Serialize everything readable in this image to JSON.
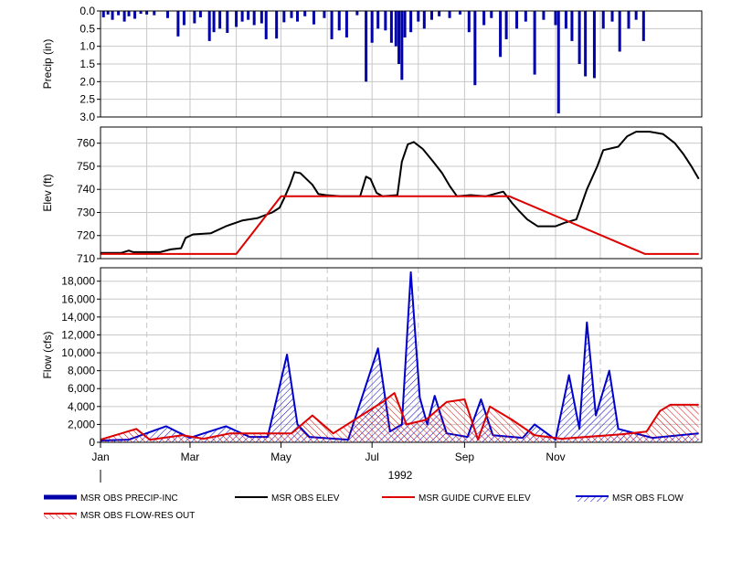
{
  "chart_data": {
    "type": "multi-panel time series",
    "x_axis": {
      "year_label": "1992",
      "tick_labels": [
        "Jan",
        "Mar",
        "May",
        "Jul",
        "Sep",
        "Nov"
      ],
      "range": [
        "1992-01-01",
        "1992-12-31"
      ]
    },
    "panels": [
      {
        "name": "precip",
        "type": "bar",
        "ylabel": "Precip (in)",
        "inverted": true,
        "ylim": [
          0,
          3.0
        ],
        "y_ticks": [
          "0.0",
          "0.5",
          "1.0",
          "1.5",
          "2.0",
          "2.5",
          "3.0"
        ],
        "series": [
          {
            "name": "MSR OBS PRECIP-INC",
            "color": "#0000aa",
            "points": [
              [
                "1992-01-03",
                0.18
              ],
              [
                "1992-01-06",
                0.1
              ],
              [
                "1992-01-09",
                0.25
              ],
              [
                "1992-01-13",
                0.12
              ],
              [
                "1992-01-17",
                0.3
              ],
              [
                "1992-01-20",
                0.15
              ],
              [
                "1992-01-24",
                0.22
              ],
              [
                "1992-01-28",
                0.08
              ],
              [
                "1992-02-01",
                0.1
              ],
              [
                "1992-02-06",
                0.12
              ],
              [
                "1992-02-15",
                0.2
              ],
              [
                "1992-02-22",
                0.72
              ],
              [
                "1992-02-26",
                0.4
              ],
              [
                "1992-03-04",
                0.35
              ],
              [
                "1992-03-08",
                0.18
              ],
              [
                "1992-03-14",
                0.85
              ],
              [
                "1992-03-17",
                0.6
              ],
              [
                "1992-03-21",
                0.5
              ],
              [
                "1992-03-26",
                0.62
              ],
              [
                "1992-04-01",
                0.45
              ],
              [
                "1992-04-05",
                0.3
              ],
              [
                "1992-04-09",
                0.25
              ],
              [
                "1992-04-13",
                0.4
              ],
              [
                "1992-04-18",
                0.35
              ],
              [
                "1992-04-21",
                0.8
              ],
              [
                "1992-04-28",
                0.78
              ],
              [
                "1992-05-03",
                0.32
              ],
              [
                "1992-05-08",
                0.2
              ],
              [
                "1992-05-12",
                0.3
              ],
              [
                "1992-05-17",
                0.15
              ],
              [
                "1992-05-23",
                0.38
              ],
              [
                "1992-05-30",
                0.2
              ],
              [
                "1992-06-04",
                0.8
              ],
              [
                "1992-06-09",
                0.55
              ],
              [
                "1992-06-14",
                0.75
              ],
              [
                "1992-06-21",
                0.12
              ],
              [
                "1992-06-27",
                2.0
              ],
              [
                "1992-07-01",
                0.9
              ],
              [
                "1992-07-05",
                0.5
              ],
              [
                "1992-07-10",
                0.55
              ],
              [
                "1992-07-14",
                0.9
              ],
              [
                "1992-07-17",
                1.0
              ],
              [
                "1992-07-19",
                1.5
              ],
              [
                "1992-07-21",
                1.95
              ],
              [
                "1992-07-23",
                0.75
              ],
              [
                "1992-07-27",
                0.6
              ],
              [
                "1992-08-01",
                0.3
              ],
              [
                "1992-08-05",
                0.5
              ],
              [
                "1992-08-10",
                0.25
              ],
              [
                "1992-08-15",
                0.15
              ],
              [
                "1992-08-22",
                0.2
              ],
              [
                "1992-08-29",
                0.1
              ],
              [
                "1992-09-04",
                0.6
              ],
              [
                "1992-09-08",
                2.1
              ],
              [
                "1992-09-14",
                0.4
              ],
              [
                "1992-09-19",
                0.2
              ],
              [
                "1992-09-25",
                1.3
              ],
              [
                "1992-09-29",
                0.8
              ],
              [
                "1992-10-06",
                0.5
              ],
              [
                "1992-10-12",
                0.3
              ],
              [
                "1992-10-18",
                1.8
              ],
              [
                "1992-10-24",
                0.25
              ],
              [
                "1992-11-01",
                0.4
              ],
              [
                "1992-11-03",
                2.9
              ],
              [
                "1992-11-08",
                0.5
              ],
              [
                "1992-11-12",
                0.85
              ],
              [
                "1992-11-17",
                1.5
              ],
              [
                "1992-11-21",
                1.85
              ],
              [
                "1992-11-27",
                1.9
              ],
              [
                "1992-12-03",
                0.5
              ],
              [
                "1992-12-09",
                0.3
              ],
              [
                "1992-12-14",
                1.15
              ],
              [
                "1992-12-20",
                0.5
              ],
              [
                "1992-12-25",
                0.25
              ],
              [
                "1992-12-30",
                0.85
              ]
            ]
          }
        ]
      },
      {
        "name": "elevation",
        "type": "line",
        "ylabel": "Elev (ft)",
        "ylim": [
          710,
          767
        ],
        "y_ticks": [
          "710",
          "720",
          "730",
          "740",
          "750",
          "760"
        ],
        "series": [
          {
            "name": "MSR OBS ELEV",
            "color": "#000000",
            "points": [
              [
                "1992-01-01",
                712.5
              ],
              [
                "1992-01-15",
                712.5
              ],
              [
                "1992-01-20",
                713.5
              ],
              [
                "1992-01-23",
                712.8
              ],
              [
                "1992-02-10",
                712.8
              ],
              [
                "1992-02-17",
                714.0
              ],
              [
                "1992-02-24",
                714.5
              ],
              [
                "1992-02-27",
                719.0
              ],
              [
                "1992-03-03",
                720.5
              ],
              [
                "1992-03-15",
                721.0
              ],
              [
                "1992-03-25",
                724.0
              ],
              [
                "1992-04-05",
                726.5
              ],
              [
                "1992-04-15",
                727.5
              ],
              [
                "1992-04-25",
                730.0
              ],
              [
                "1992-04-30",
                732.0
              ],
              [
                "1992-05-03",
                736.0
              ],
              [
                "1992-05-07",
                742.0
              ],
              [
                "1992-05-10",
                747.5
              ],
              [
                "1992-05-14",
                747.0
              ],
              [
                "1992-05-18",
                744.5
              ],
              [
                "1992-05-22",
                742.0
              ],
              [
                "1992-05-26",
                738.0
              ],
              [
                "1992-05-31",
                737.5
              ],
              [
                "1992-06-10",
                737.0
              ],
              [
                "1992-06-23",
                737.0
              ],
              [
                "1992-06-27",
                745.5
              ],
              [
                "1992-06-30",
                744.5
              ],
              [
                "1992-07-04",
                738.5
              ],
              [
                "1992-07-08",
                737.0
              ],
              [
                "1992-07-18",
                737.5
              ],
              [
                "1992-07-21",
                752.0
              ],
              [
                "1992-07-25",
                759.5
              ],
              [
                "1992-07-29",
                760.5
              ],
              [
                "1992-08-04",
                757.5
              ],
              [
                "1992-08-11",
                752.0
              ],
              [
                "1992-08-17",
                747.0
              ],
              [
                "1992-08-22",
                741.5
              ],
              [
                "1992-08-27",
                737.0
              ],
              [
                "1992-09-05",
                737.5
              ],
              [
                "1992-09-15",
                737.0
              ],
              [
                "1992-09-27",
                739.0
              ],
              [
                "1992-10-03",
                734.0
              ],
              [
                "1992-10-07",
                731.0
              ],
              [
                "1992-10-13",
                727.0
              ],
              [
                "1992-10-20",
                724.0
              ],
              [
                "1992-11-01",
                724.0
              ],
              [
                "1992-11-07",
                725.5
              ],
              [
                "1992-11-15",
                727.0
              ],
              [
                "1992-11-22",
                740.0
              ],
              [
                "1992-11-29",
                750.0
              ],
              [
                "1992-12-03",
                757.0
              ],
              [
                "1992-12-13",
                758.5
              ],
              [
                "1992-12-19",
                763.0
              ],
              [
                "1992-12-25",
                765.0
              ],
              [
                "1993-01-03",
                765.0
              ],
              [
                "1993-01-12",
                764.0
              ],
              [
                "1993-01-20",
                760.0
              ],
              [
                "1993-01-26",
                755.0
              ],
              [
                "1993-01-31",
                750.0
              ],
              [
                "1993-02-05",
                744.5
              ]
            ]
          },
          {
            "name": "MSR GUIDE CURVE ELEV",
            "color": "#dd0000",
            "points": [
              [
                "1992-01-01",
                712.0
              ],
              [
                "1992-04-01",
                712.0
              ],
              [
                "1992-05-01",
                737.0
              ],
              [
                "1992-10-01",
                737.0
              ],
              [
                "1992-12-31",
                712.0
              ],
              [
                "1993-02-05",
                712.0
              ]
            ]
          }
        ]
      },
      {
        "name": "flow",
        "type": "area",
        "ylabel": "Flow (cfs)",
        "ylim": [
          0,
          19500
        ],
        "y_ticks": [
          "0",
          "2,000",
          "4,000",
          "6,000",
          "8,000",
          "10,000",
          "12,000",
          "14,000",
          "16,000",
          "18,000"
        ],
        "series": [
          {
            "name": "MSR OBS FLOW",
            "color": "#0000cc",
            "points": [
              [
                "1992-01-01",
                200
              ],
              [
                "1992-01-20",
                300
              ],
              [
                "1992-02-14",
                1800
              ],
              [
                "1992-02-21",
                1200
              ],
              [
                "1992-03-01",
                500
              ],
              [
                "1992-03-25",
                1800
              ],
              [
                "1992-04-10",
                600
              ],
              [
                "1992-04-22",
                600
              ],
              [
                "1992-05-05",
                9800
              ],
              [
                "1992-05-12",
                2000
              ],
              [
                "1992-05-20",
                600
              ],
              [
                "1992-06-15",
                300
              ],
              [
                "1992-07-05",
                10500
              ],
              [
                "1992-07-13",
                1200
              ],
              [
                "1992-07-21",
                2000
              ],
              [
                "1992-07-27",
                19000
              ],
              [
                "1992-08-02",
                5000
              ],
              [
                "1992-08-07",
                2000
              ],
              [
                "1992-08-12",
                5200
              ],
              [
                "1992-08-20",
                1000
              ],
              [
                "1992-09-03",
                600
              ],
              [
                "1992-09-12",
                4800
              ],
              [
                "1992-09-20",
                800
              ],
              [
                "1992-10-10",
                500
              ],
              [
                "1992-10-18",
                2000
              ],
              [
                "1992-11-01",
                300
              ],
              [
                "1992-11-10",
                7500
              ],
              [
                "1992-11-17",
                1500
              ],
              [
                "1992-11-22",
                13400
              ],
              [
                "1992-11-28",
                3000
              ],
              [
                "1992-12-07",
                8000
              ],
              [
                "1992-12-13",
                1500
              ],
              [
                "1993-01-05",
                500
              ],
              [
                "1993-02-05",
                1000
              ]
            ]
          },
          {
            "name": "MSR OBS FLOW-RES OUT",
            "color": "#dd0000",
            "points": [
              [
                "1992-01-01",
                300
              ],
              [
                "1992-01-25",
                1500
              ],
              [
                "1992-02-03",
                300
              ],
              [
                "1992-02-25",
                800
              ],
              [
                "1992-03-10",
                400
              ],
              [
                "1992-03-28",
                1000
              ],
              [
                "1992-04-20",
                1000
              ],
              [
                "1992-05-08",
                1000
              ],
              [
                "1992-05-22",
                3000
              ],
              [
                "1992-06-05",
                1000
              ],
              [
                "1992-07-08",
                4500
              ],
              [
                "1992-07-16",
                5500
              ],
              [
                "1992-07-24",
                2000
              ],
              [
                "1992-08-06",
                2500
              ],
              [
                "1992-08-20",
                4500
              ],
              [
                "1992-09-01",
                4800
              ],
              [
                "1992-09-10",
                300
              ],
              [
                "1992-09-18",
                4000
              ],
              [
                "1992-10-03",
                2500
              ],
              [
                "1992-10-18",
                800
              ],
              [
                "1992-11-05",
                400
              ],
              [
                "1992-12-15",
                900
              ],
              [
                "1993-01-01",
                1200
              ],
              [
                "1993-01-10",
                3500
              ],
              [
                "1993-01-17",
                4200
              ],
              [
                "1993-02-05",
                4200
              ]
            ]
          }
        ]
      }
    ],
    "legend": {
      "placement": "bottom",
      "items": [
        {
          "label": "MSR OBS PRECIP-INC",
          "style": "thick-line",
          "color": "#0000aa"
        },
        {
          "label": "MSR OBS ELEV",
          "style": "line",
          "color": "#000000"
        },
        {
          "label": "MSR GUIDE CURVE ELEV",
          "style": "line",
          "color": "#dd0000"
        },
        {
          "label": "MSR OBS FLOW",
          "style": "hatched",
          "color": "#0000cc"
        },
        {
          "label": "MSR OBS FLOW-RES OUT",
          "style": "hatched",
          "color": "#dd0000"
        }
      ]
    }
  }
}
